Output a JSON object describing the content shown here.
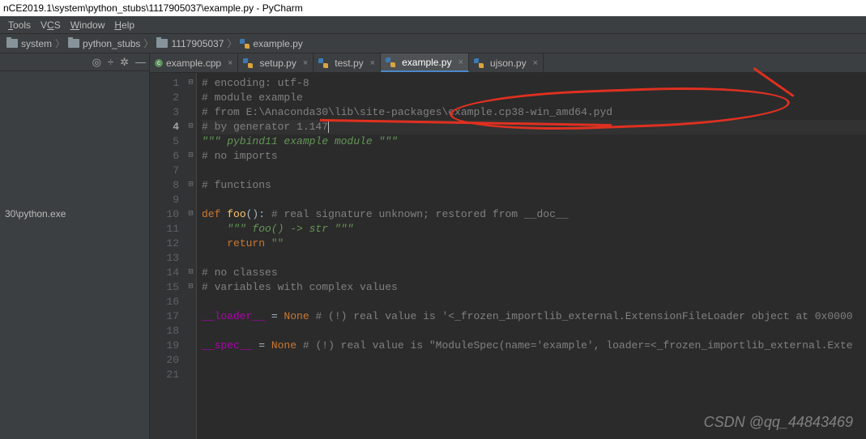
{
  "window_title": "nCE2019.1\\system\\python_stubs\\1117905037\\example.py - PyCharm",
  "menu": {
    "tools": "Tools",
    "vcs": "VCS",
    "window": "Window",
    "help": "Help"
  },
  "breadcrumb": [
    {
      "label": "system",
      "icon": "folder"
    },
    {
      "label": "python_stubs",
      "icon": "folder"
    },
    {
      "label": "1117905037",
      "icon": "folder"
    },
    {
      "label": "example.py",
      "icon": "pyfile"
    }
  ],
  "sidebar": {
    "interpreter_path": "30\\python.exe"
  },
  "tabs": [
    {
      "label": "example.cpp",
      "icon": "cfile",
      "active": false
    },
    {
      "label": "setup.py",
      "icon": "pyfile",
      "active": false
    },
    {
      "label": "test.py",
      "icon": "pyfile",
      "active": false
    },
    {
      "label": "example.py",
      "icon": "pyfile",
      "active": true
    },
    {
      "label": "ujson.py",
      "icon": "pyfile",
      "active": false
    }
  ],
  "editor": {
    "current_line": 4,
    "lines": [
      {
        "n": 1,
        "fold": "⊟",
        "segments": [
          {
            "cls": "c-comment",
            "t": "# encoding: utf-8"
          }
        ]
      },
      {
        "n": 2,
        "segments": [
          {
            "cls": "c-comment",
            "t": "# module example"
          }
        ]
      },
      {
        "n": 3,
        "segments": [
          {
            "cls": "c-comment",
            "t": "# from E:\\Anaconda30\\lib\\site-packages\\example.cp38-win_amd64.pyd"
          }
        ]
      },
      {
        "n": 4,
        "fold": "⊟",
        "hl": true,
        "segments": [
          {
            "cls": "c-comment",
            "t": "# by generator 1.147"
          }
        ],
        "caret": true
      },
      {
        "n": 5,
        "segments": [
          {
            "cls": "c-docstr",
            "t": "\"\"\" pybind11 example module \"\"\""
          }
        ]
      },
      {
        "n": 6,
        "fold": "⊟",
        "segments": [
          {
            "cls": "c-comment",
            "t": "# no imports"
          }
        ]
      },
      {
        "n": 7,
        "segments": []
      },
      {
        "n": 8,
        "fold": "⊟",
        "segments": [
          {
            "cls": "c-comment",
            "t": "# functions"
          }
        ]
      },
      {
        "n": 9,
        "segments": []
      },
      {
        "n": 10,
        "fold": "⊟",
        "segments": [
          {
            "cls": "c-keyword",
            "t": "def "
          },
          {
            "cls": "c-fn",
            "t": "foo"
          },
          {
            "cls": "",
            "t": "(): "
          },
          {
            "cls": "c-comment",
            "t": "# real signature unknown; restored from __doc__"
          }
        ]
      },
      {
        "n": 11,
        "segments": [
          {
            "cls": "",
            "t": "    "
          },
          {
            "cls": "c-docstr",
            "t": "\"\"\" foo() -> str \"\"\""
          }
        ]
      },
      {
        "n": 12,
        "segments": [
          {
            "cls": "",
            "t": "    "
          },
          {
            "cls": "c-keyword",
            "t": "return "
          },
          {
            "cls": "c-str",
            "t": "\"\""
          }
        ]
      },
      {
        "n": 13,
        "segments": []
      },
      {
        "n": 14,
        "fold": "⊟",
        "segments": [
          {
            "cls": "c-comment",
            "t": "# no classes"
          }
        ]
      },
      {
        "n": 15,
        "fold": "⊟",
        "segments": [
          {
            "cls": "c-comment",
            "t": "# variables with complex values"
          }
        ]
      },
      {
        "n": 16,
        "segments": []
      },
      {
        "n": 17,
        "segments": [
          {
            "cls": "c-magic",
            "t": "__loader__"
          },
          {
            "cls": "",
            "t": " = "
          },
          {
            "cls": "c-none",
            "t": "None"
          },
          {
            "cls": "",
            "t": " "
          },
          {
            "cls": "c-comment",
            "t": "# (!) real value is '<_frozen_importlib_external.ExtensionFileLoader object at 0x0000"
          }
        ]
      },
      {
        "n": 18,
        "segments": []
      },
      {
        "n": 19,
        "segments": [
          {
            "cls": "c-magic",
            "t": "__spec__"
          },
          {
            "cls": "",
            "t": " = "
          },
          {
            "cls": "c-none",
            "t": "None"
          },
          {
            "cls": "",
            "t": " "
          },
          {
            "cls": "c-comment",
            "t": "# (!) real value is \"ModuleSpec(name='example', loader=<_frozen_importlib_external.Exte"
          }
        ]
      },
      {
        "n": 20,
        "segments": []
      },
      {
        "n": 21,
        "segments": []
      }
    ]
  },
  "watermark": "CSDN @qq_44843469"
}
